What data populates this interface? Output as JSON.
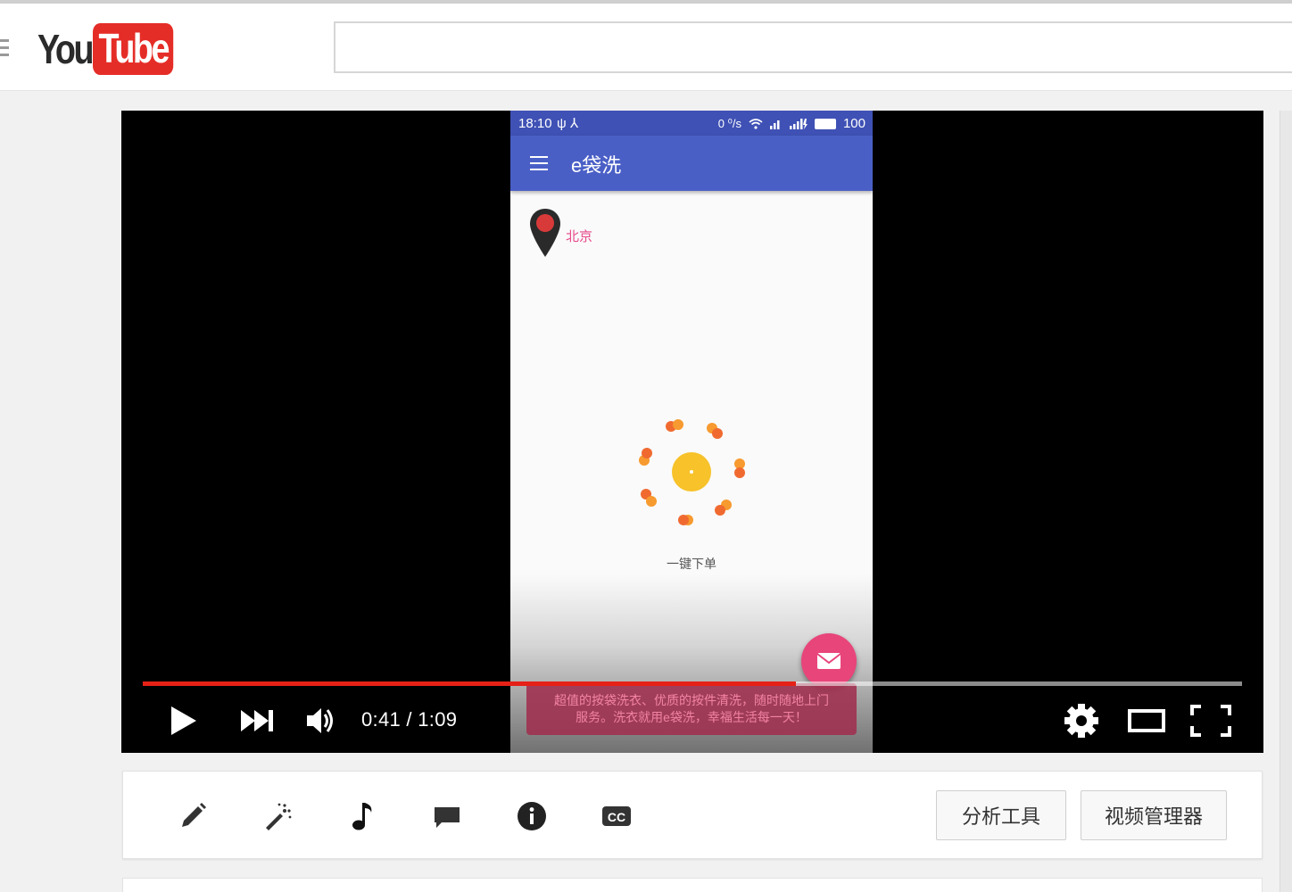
{
  "header": {
    "logo_you": "You",
    "logo_tube": "Tube",
    "search_value": ""
  },
  "video": {
    "status_bar": {
      "time": "18:10",
      "usb_icons": "ψ ⅄",
      "net_speed": "0 ⁰/s",
      "battery_level": "100"
    },
    "app_title": "e袋洗",
    "city": "北京",
    "order_label": "一键下单",
    "toast_line1": "超值的按袋洗衣、优质的按件清洗，随时随地上门",
    "toast_line2": "服务。洗衣就用e袋洗，幸福生活每一天！"
  },
  "player_controls": {
    "current_time": "0:41",
    "duration": "1:09",
    "time_text": "0:41 / 1:09",
    "progress_fraction": 0.594,
    "progress_color": "#e62117",
    "icons": [
      "play-icon",
      "next-icon",
      "volume-icon",
      "settings-gear-icon",
      "theater-mode-icon",
      "fullscreen-icon"
    ]
  },
  "toolbar": {
    "icons": [
      "pencil-icon",
      "magic-wand-icon",
      "music-note-icon",
      "comment-icon",
      "info-icon",
      "cc-icon"
    ],
    "analytics_label": "分析工具",
    "video_manager_label": "视频管理器"
  },
  "colors": {
    "brand_red": "#e52d27",
    "app_bar": "#4a5fc6",
    "status_bar": "#3f51b5",
    "accent_pink": "#e8457a"
  }
}
